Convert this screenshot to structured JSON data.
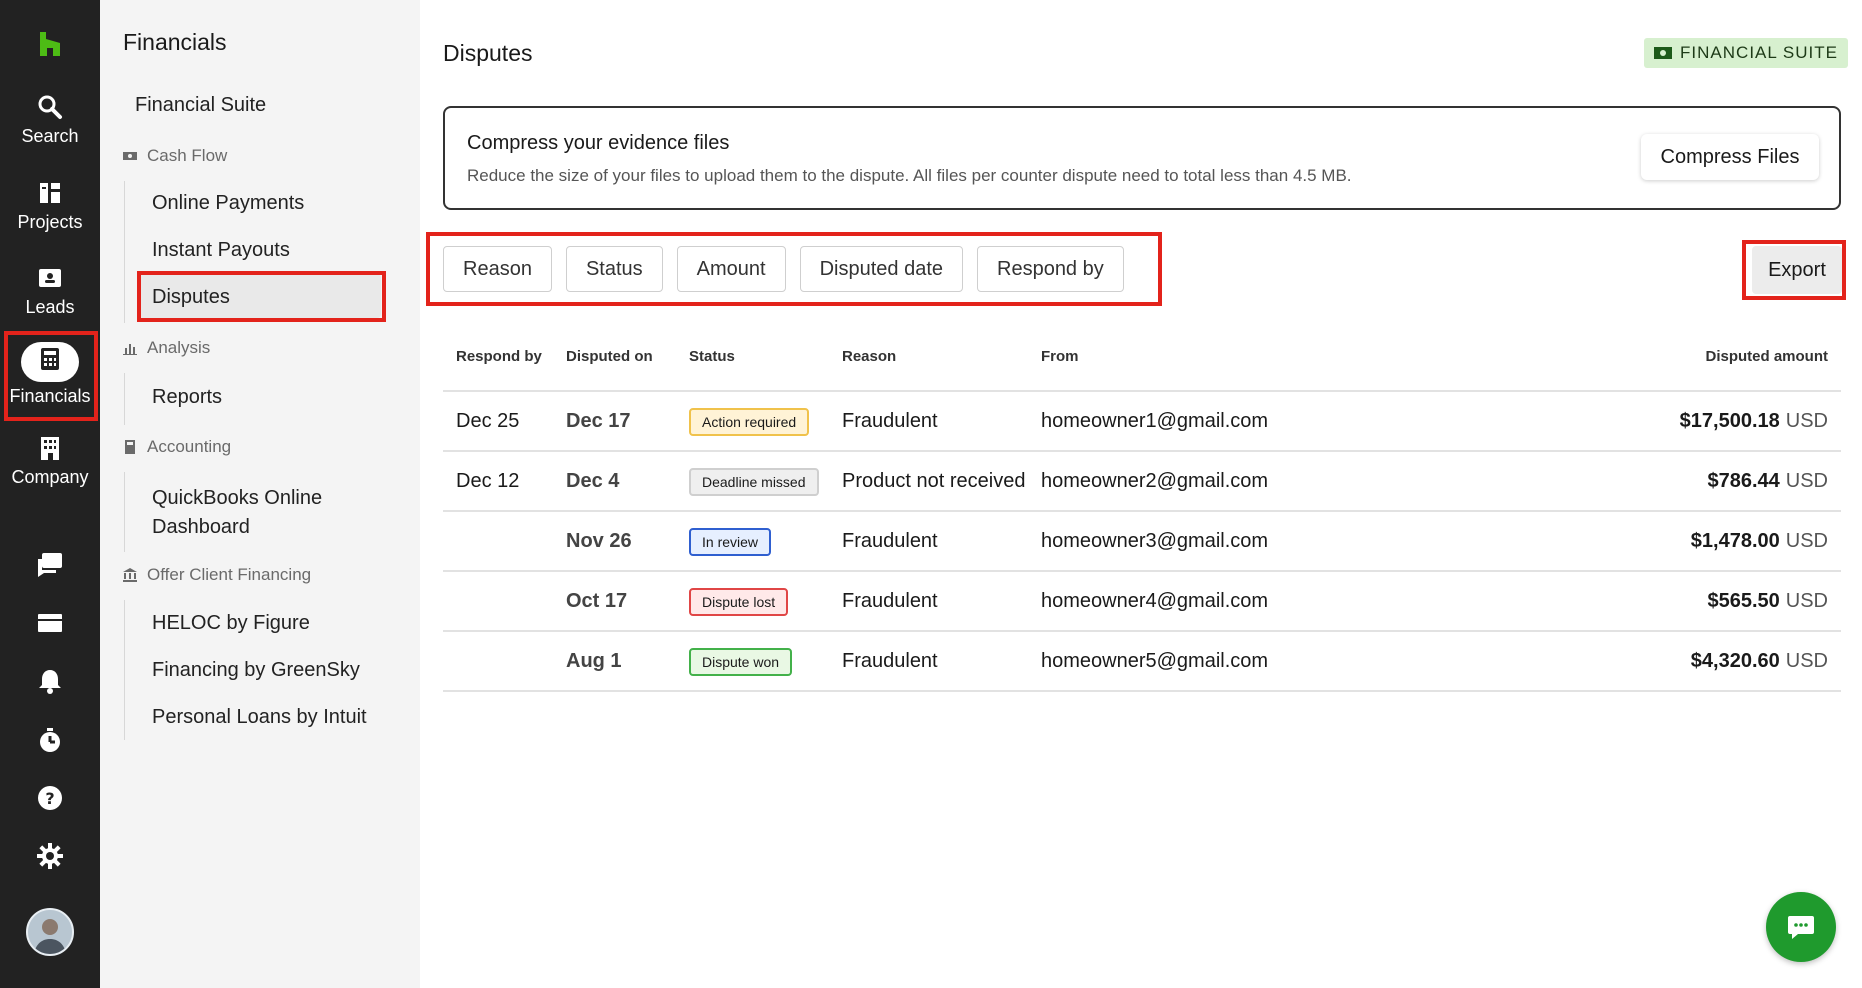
{
  "rail": {
    "items": [
      {
        "label": "Search",
        "icon": "search-icon"
      },
      {
        "label": "Projects",
        "icon": "projects-icon"
      },
      {
        "label": "Leads",
        "icon": "leads-icon"
      },
      {
        "label": "Financials",
        "icon": "financials-icon",
        "active": true
      },
      {
        "label": "Company",
        "icon": "company-icon"
      }
    ],
    "utility_icons": [
      "messages-icon",
      "inbox-icon",
      "bell-icon",
      "timer-icon",
      "help-icon",
      "gear-icon"
    ]
  },
  "subnav": {
    "title": "Financials",
    "top_link": "Financial Suite",
    "sections": [
      {
        "label": "Cash Flow",
        "links": [
          "Online Payments",
          "Instant Payouts",
          "Disputes"
        ]
      },
      {
        "label": "Analysis",
        "links": [
          "Reports"
        ]
      },
      {
        "label": "Accounting",
        "links": [
          "QuickBooks Online Dashboard"
        ]
      },
      {
        "label": "Offer Client Financing",
        "links": [
          "HELOC by Figure",
          "Financing by GreenSky",
          "Personal Loans by Intuit"
        ]
      }
    ],
    "active": "Disputes"
  },
  "header": {
    "title": "Disputes",
    "badge": "FINANCIAL SUITE"
  },
  "banner": {
    "title": "Compress your evidence files",
    "description": "Reduce the size of your files to upload them to the dispute. All files per counter dispute need to total less than 4.5 MB.",
    "button": "Compress Files"
  },
  "filters": [
    "Reason",
    "Status",
    "Amount",
    "Disputed date",
    "Respond by"
  ],
  "export_label": "Export",
  "table": {
    "columns": [
      "Respond by",
      "Disputed on",
      "Status",
      "Reason",
      "From",
      "Disputed amount"
    ],
    "rows": [
      {
        "respond_by": "Dec 25",
        "disputed_on": "Dec 17",
        "status": "Action required",
        "reason": "Fraudulent",
        "from": "homeowner1@gmail.com",
        "amount": "$17,500.18",
        "currency": "USD"
      },
      {
        "respond_by": "Dec 12",
        "disputed_on": "Dec 4",
        "status": "Deadline missed",
        "reason": "Product not received",
        "from": "homeowner2@gmail.com",
        "amount": "$786.44",
        "currency": "USD"
      },
      {
        "respond_by": "",
        "disputed_on": "Nov 26",
        "status": "In review",
        "reason": "Fraudulent",
        "from": "homeowner3@gmail.com",
        "amount": "$1,478.00",
        "currency": "USD"
      },
      {
        "respond_by": "",
        "disputed_on": "Oct 17",
        "status": "Dispute lost",
        "reason": "Fraudulent",
        "from": "homeowner4@gmail.com",
        "amount": "$565.50",
        "currency": "USD"
      },
      {
        "respond_by": "",
        "disputed_on": "Aug 1",
        "status": "Dispute won",
        "reason": "Fraudulent",
        "from": "homeowner5@gmail.com",
        "amount": "$4,320.60",
        "currency": "USD"
      }
    ]
  },
  "status_colors": {
    "Action required": {
      "bg": "#fff3d6",
      "border": "#f0c24b"
    },
    "Deadline missed": {
      "bg": "#efefef",
      "border": "#cfcfcf"
    },
    "In review": {
      "bg": "#e6efff",
      "border": "#2f5fd0"
    },
    "Dispute lost": {
      "bg": "#ffe9e9",
      "border": "#e04646"
    },
    "Dispute won": {
      "bg": "#e9f8e4",
      "border": "#43b14a"
    }
  },
  "colors": {
    "accent": "#1f9a2d",
    "highlight": "#e3231b",
    "rail": "#222222"
  }
}
